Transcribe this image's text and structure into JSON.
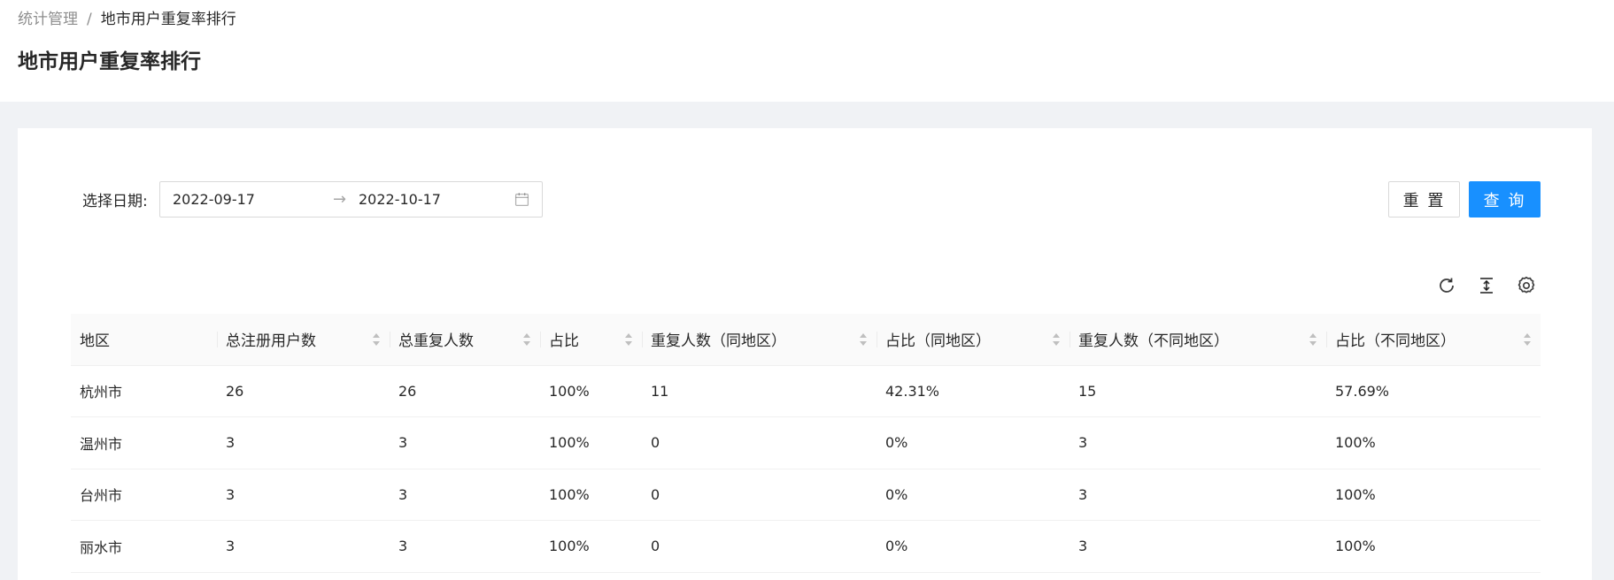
{
  "breadcrumb": {
    "parent": "统计管理",
    "separator": "/",
    "current": "地市用户重复率排行"
  },
  "page_title": "地市用户重复率排行",
  "filter": {
    "label": "选择日期:",
    "start_date": "2022-09-17",
    "separator": "→",
    "end_date": "2022-10-17",
    "icon": "calendar-icon"
  },
  "buttons": {
    "reset": "重 置",
    "query": "查 询"
  },
  "toolbar": {
    "icons": [
      "reload-icon",
      "column-height-icon",
      "setting-icon"
    ]
  },
  "colors": {
    "primary": "#1890ff",
    "header_bg": "#fafafa",
    "page_bg": "#f0f2f5"
  },
  "table": {
    "columns": [
      "地区",
      "总注册用户数",
      "总重复人数",
      "占比",
      "重复人数（同地区）",
      "占比（同地区）",
      "重复人数（不同地区）",
      "占比（不同地区）"
    ],
    "rows": [
      [
        "杭州市",
        "26",
        "26",
        "100%",
        "11",
        "42.31%",
        "15",
        "57.69%"
      ],
      [
        "温州市",
        "3",
        "3",
        "100%",
        "0",
        "0%",
        "3",
        "100%"
      ],
      [
        "台州市",
        "3",
        "3",
        "100%",
        "0",
        "0%",
        "3",
        "100%"
      ],
      [
        "丽水市",
        "3",
        "3",
        "100%",
        "0",
        "0%",
        "3",
        "100%"
      ]
    ]
  }
}
